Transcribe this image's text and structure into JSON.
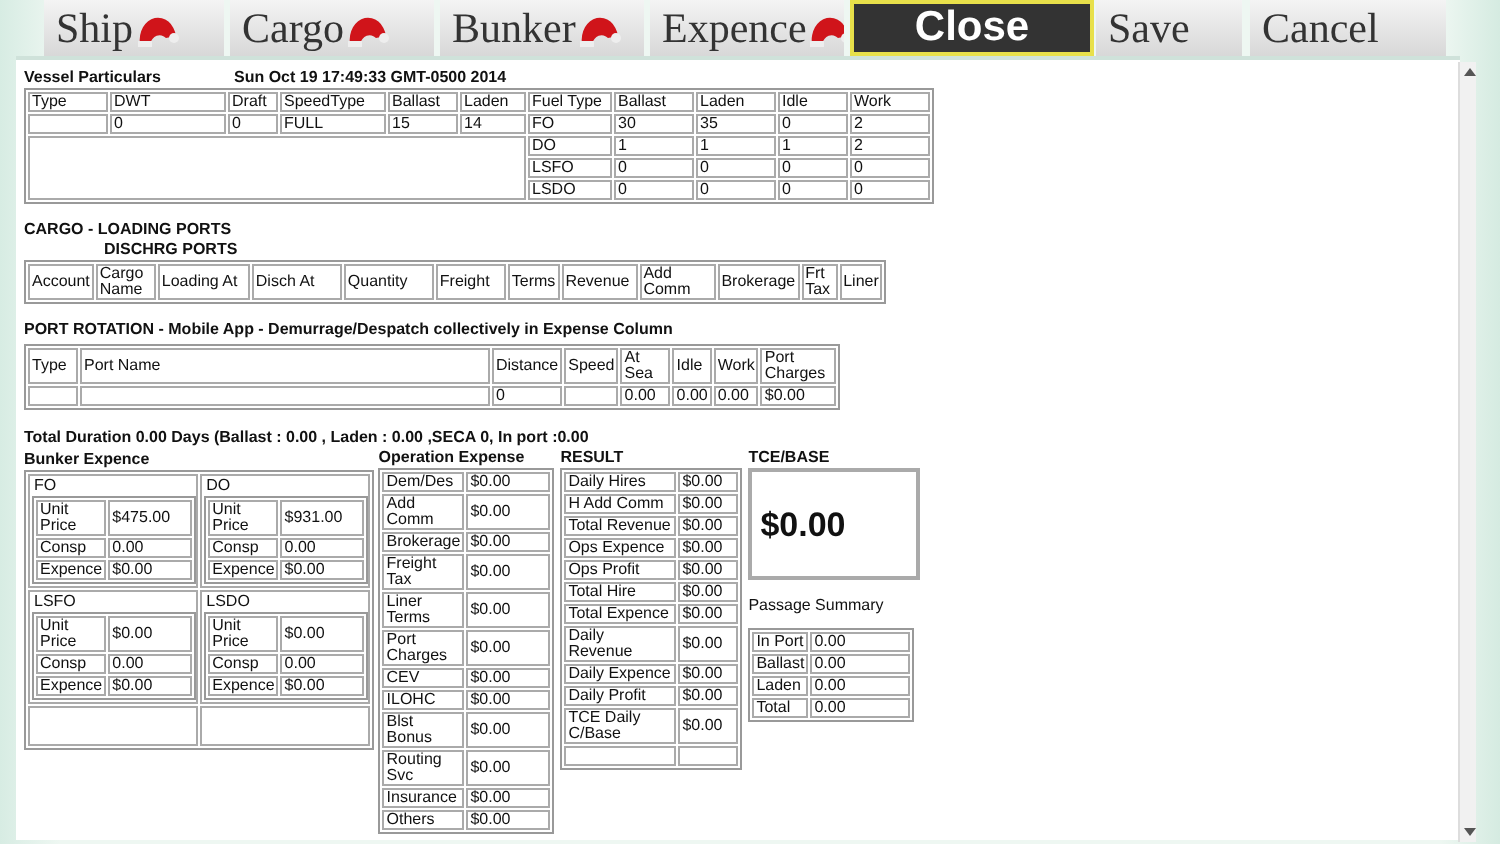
{
  "tabs": [
    {
      "label": "Ship",
      "kind": "hat",
      "selected": false
    },
    {
      "label": "Cargo",
      "kind": "hat",
      "selected": false
    },
    {
      "label": "Bunker",
      "kind": "hat",
      "selected": false
    },
    {
      "label": "Expence",
      "kind": "hat",
      "selected": false
    },
    {
      "label": "Close",
      "kind": "plain",
      "selected": true
    },
    {
      "label": "Save",
      "kind": "plain",
      "selected": false
    },
    {
      "label": "Cancel",
      "kind": "plain",
      "selected": false
    }
  ],
  "vessel": {
    "title": "Vessel Particulars",
    "timestamp": "Sun Oct 19 17:49:33 GMT-0500 2014",
    "columns": [
      "Type",
      "DWT",
      "Draft",
      "SpeedType",
      "Ballast",
      "Laden"
    ],
    "values": [
      "0",
      "0",
      "FULL",
      "15",
      "14"
    ],
    "fuel_columns": [
      "Fuel Type",
      "Ballast",
      "Laden",
      "Idle",
      "Work"
    ],
    "fuel_rows": [
      [
        "FO",
        "30",
        "35",
        "0",
        "2"
      ],
      [
        "DO",
        "1",
        "1",
        "1",
        "2"
      ],
      [
        "LSFO",
        "0",
        "0",
        "0",
        "0"
      ],
      [
        "LSDO",
        "0",
        "0",
        "0",
        "0"
      ]
    ]
  },
  "cargo": {
    "title": "CARGO  - LOADING PORTS",
    "subtitle": "DISCHRG PORTS",
    "columns": [
      "Account",
      "Cargo Name",
      "Loading At",
      "Disch At",
      "Quantity",
      "Freight",
      "Terms",
      "Revenue",
      "Add Comm",
      "Brokerage",
      "Frt Tax",
      "Liner"
    ]
  },
  "port_rotation": {
    "title": "PORT ROTATION - Mobile App - Demurrage/Despatch collectively in Expense Column",
    "columns": [
      "Type",
      "Port Name",
      "Distance",
      "Speed",
      "At Sea",
      "Idle",
      "Work",
      "Port Charges"
    ],
    "rows": [
      [
        null,
        null,
        "0",
        null,
        "0.00",
        "0.00",
        "0.00",
        "$0.00"
      ]
    ]
  },
  "total_duration": "Total Duration 0.00 Days (Ballast : 0.00 , Laden : 0.00 ,SECA 0,  In port :0.00",
  "bunker": {
    "title": "Bunker Expence",
    "groups": [
      {
        "name": "FO",
        "rows": [
          [
            "Unit Price",
            "$475.00"
          ],
          [
            "Consp",
            "0.00"
          ],
          [
            "Expence",
            "$0.00"
          ]
        ]
      },
      {
        "name": "DO",
        "rows": [
          [
            "Unit Price",
            "$931.00"
          ],
          [
            "Consp",
            "0.00"
          ],
          [
            "Expence",
            "$0.00"
          ]
        ]
      },
      {
        "name": "LSFO",
        "rows": [
          [
            "Unit Price",
            "$0.00"
          ],
          [
            "Consp",
            "0.00"
          ],
          [
            "Expence",
            "$0.00"
          ]
        ]
      },
      {
        "name": "LSDO",
        "rows": [
          [
            "Unit Price",
            "$0.00"
          ],
          [
            "Consp",
            "0.00"
          ],
          [
            "Expence",
            "$0.00"
          ]
        ]
      }
    ]
  },
  "operation": {
    "title": "Operation Expense",
    "rows": [
      [
        "Dem/Des",
        "$0.00"
      ],
      [
        "Add Comm",
        "$0.00"
      ],
      [
        "Brokerage",
        "$0.00"
      ],
      [
        "Freight Tax",
        "$0.00"
      ],
      [
        "Liner Terms",
        "$0.00"
      ],
      [
        "Port Charges",
        "$0.00"
      ],
      [
        "CEV",
        "$0.00"
      ],
      [
        "ILOHC",
        "$0.00"
      ],
      [
        "Blst Bonus",
        "$0.00"
      ],
      [
        "Routing Svc",
        "$0.00"
      ],
      [
        "Insurance",
        "$0.00"
      ],
      [
        "Others",
        "$0.00"
      ]
    ]
  },
  "result": {
    "title": "RESULT",
    "rows": [
      [
        "Daily Hires",
        "$0.00"
      ],
      [
        "H Add Comm",
        "$0.00"
      ],
      [
        "Total Revenue",
        "$0.00"
      ],
      [
        "Ops Expence",
        "$0.00"
      ],
      [
        "Ops Profit",
        "$0.00"
      ],
      [
        "Total Hire",
        "$0.00"
      ],
      [
        "Total Expence",
        "$0.00"
      ],
      [
        "Daily Revenue",
        "$0.00"
      ],
      [
        "Daily Expence",
        "$0.00"
      ],
      [
        "Daily Profit",
        "$0.00"
      ],
      [
        "TCE Daily C/Base",
        "$0.00"
      ],
      [
        null,
        null
      ]
    ]
  },
  "tce": {
    "title": "TCE/BASE",
    "value": "$0.00"
  },
  "passage": {
    "title": "Passage Summary",
    "rows": [
      [
        "In Port",
        "0.00"
      ],
      [
        "Ballast",
        "0.00"
      ],
      [
        "Laden",
        "0.00"
      ],
      [
        "Total",
        "0.00"
      ]
    ]
  }
}
